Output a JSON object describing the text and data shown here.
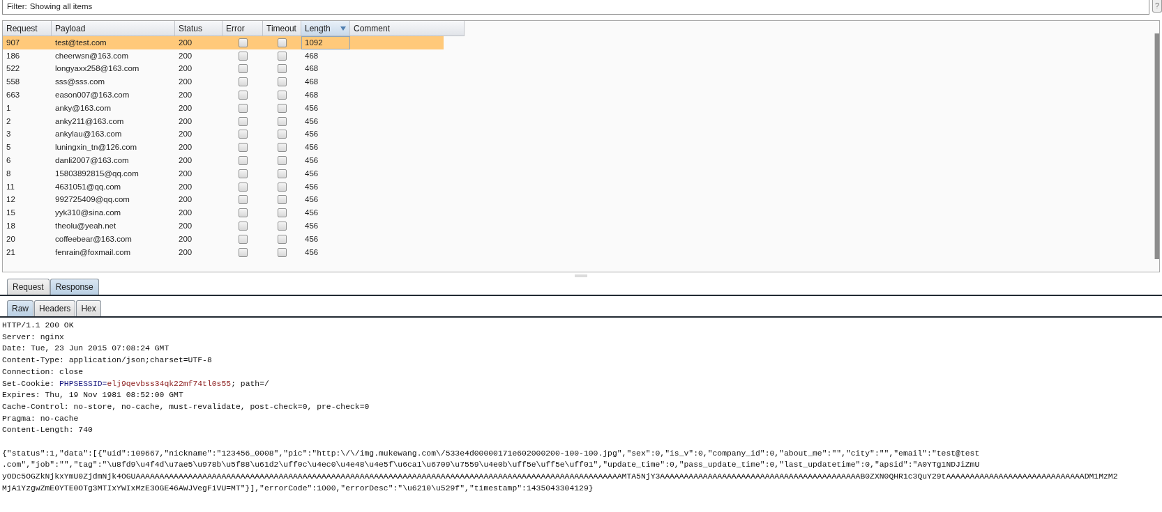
{
  "filter": {
    "label": "Filter:",
    "value": "Showing all items"
  },
  "help_button": {
    "label": "?"
  },
  "table": {
    "columns": [
      {
        "label": "Request",
        "sorted": false
      },
      {
        "label": "Payload",
        "sorted": false
      },
      {
        "label": "Status",
        "sorted": false
      },
      {
        "label": "Error",
        "sorted": false
      },
      {
        "label": "Timeout",
        "sorted": false
      },
      {
        "label": "Length",
        "sorted": true
      },
      {
        "label": "Comment",
        "sorted": false
      }
    ],
    "rows": [
      {
        "request": "907",
        "payload": "test@test.com",
        "status": "200",
        "error": false,
        "timeout": false,
        "length": "1092",
        "selected": true
      },
      {
        "request": "186",
        "payload": "cheerwsn@163.com",
        "status": "200",
        "error": false,
        "timeout": false,
        "length": "468",
        "selected": false
      },
      {
        "request": "522",
        "payload": "longyaxx258@163.com",
        "status": "200",
        "error": false,
        "timeout": false,
        "length": "468",
        "selected": false
      },
      {
        "request": "558",
        "payload": "sss@sss.com",
        "status": "200",
        "error": false,
        "timeout": false,
        "length": "468",
        "selected": false
      },
      {
        "request": "663",
        "payload": "eason007@163.com",
        "status": "200",
        "error": false,
        "timeout": false,
        "length": "468",
        "selected": false
      },
      {
        "request": "1",
        "payload": "anky@163.com",
        "status": "200",
        "error": false,
        "timeout": false,
        "length": "456",
        "selected": false
      },
      {
        "request": "2",
        "payload": "anky211@163.com",
        "status": "200",
        "error": false,
        "timeout": false,
        "length": "456",
        "selected": false
      },
      {
        "request": "3",
        "payload": "ankylau@163.com",
        "status": "200",
        "error": false,
        "timeout": false,
        "length": "456",
        "selected": false
      },
      {
        "request": "5",
        "payload": "luningxin_tn@126.com",
        "status": "200",
        "error": false,
        "timeout": false,
        "length": "456",
        "selected": false
      },
      {
        "request": "6",
        "payload": "danli2007@163.com",
        "status": "200",
        "error": false,
        "timeout": false,
        "length": "456",
        "selected": false
      },
      {
        "request": "8",
        "payload": "15803892815@qq.com",
        "status": "200",
        "error": false,
        "timeout": false,
        "length": "456",
        "selected": false
      },
      {
        "request": "11",
        "payload": "4631051@qq.com",
        "status": "200",
        "error": false,
        "timeout": false,
        "length": "456",
        "selected": false
      },
      {
        "request": "12",
        "payload": "992725409@qq.com",
        "status": "200",
        "error": false,
        "timeout": false,
        "length": "456",
        "selected": false
      },
      {
        "request": "15",
        "payload": "yyk310@sina.com",
        "status": "200",
        "error": false,
        "timeout": false,
        "length": "456",
        "selected": false
      },
      {
        "request": "18",
        "payload": "theolu@yeah.net",
        "status": "200",
        "error": false,
        "timeout": false,
        "length": "456",
        "selected": false
      },
      {
        "request": "20",
        "payload": "coffeebear@163.com",
        "status": "200",
        "error": false,
        "timeout": false,
        "length": "456",
        "selected": false
      },
      {
        "request": "21",
        "payload": "fenrain@foxmail.com",
        "status": "200",
        "error": false,
        "timeout": false,
        "length": "456",
        "selected": false
      }
    ]
  },
  "message_tabs": [
    {
      "label": "Request",
      "selected": false
    },
    {
      "label": "Response",
      "selected": true
    }
  ],
  "view_tabs": [
    {
      "label": "Raw",
      "selected": true
    },
    {
      "label": "Headers",
      "selected": false
    },
    {
      "label": "Hex",
      "selected": false
    }
  ],
  "response_lines": [
    {
      "kind": "plain",
      "text": "HTTP/1.1 200 OK"
    },
    {
      "kind": "plain",
      "text": "Server: nginx"
    },
    {
      "kind": "plain",
      "text": "Date: Tue, 23 Jun 2015 07:08:24 GMT"
    },
    {
      "kind": "plain",
      "text": "Content-Type: application/json;charset=UTF-8"
    },
    {
      "kind": "plain",
      "text": "Connection: close"
    },
    {
      "kind": "cookie",
      "label": "Set-Cookie: ",
      "name": "PHPSESSID=",
      "value": "elj9qevbss34qk22mf74tl0s55",
      "rest": "; path=/"
    },
    {
      "kind": "plain",
      "text": "Expires: Thu, 19 Nov 1981 08:52:00 GMT"
    },
    {
      "kind": "plain",
      "text": "Cache-Control: no-store, no-cache, must-revalidate, post-check=0, pre-check=0"
    },
    {
      "kind": "plain",
      "text": "Pragma: no-cache"
    },
    {
      "kind": "plain",
      "text": "Content-Length: 740"
    },
    {
      "kind": "blank"
    },
    {
      "kind": "plain",
      "text": "{\"status\":1,\"data\":[{\"uid\":109667,\"nickname\":\"123456_0008\",\"pic\":\"http:\\/\\/img.mukewang.com\\/533e4d00000171e602000200-100-100.jpg\",\"sex\":0,\"is_v\":0,\"company_id\":0,\"about_me\":\"\",\"city\":\"\",\"email\":\"test@test"
    },
    {
      "kind": "plain",
      "text": ".com\",\"job\":\"\",\"tag\":\"\\u8fd9\\u4f4d\\u7ae5\\u978b\\u5f88\\u61d2\\uff0c\\u4ec0\\u4e48\\u4e5f\\u6ca1\\u6709\\u7559\\u4e0b\\uff5e\\uff5e\\uff01\",\"update_time\":0,\"pass_update_time\":0,\"last_updatetime\":0,\"apsid\":\"A0YTg1NDJiZmU"
    },
    {
      "kind": "plain",
      "text": "yODc5OGZkNjkxYmU0ZjdmNjk4OGUAAAAAAAAAAAAAAAAAAAAAAAAAAAAAAAAAAAAAAAAAAAAAAAAAAAAAAAAAAAAAAAAAAAAAAAAAAAAAAAAAAAAAAAAAAAAAAAAAAAAAAMTA5NjY3AAAAAAAAAAAAAAAAAAAAAAAAAAAAAAAAAAAAAAAAAAB0ZXN0QHR1c3QuY29tAAAAAAAAAAAAAAAAAAAAAAAAAAAAADM1MzM2"
    },
    {
      "kind": "plain",
      "text": "MjA1YzgwZmE0YTE0OTg3MTIxYWIxMzE3OGE46AWJVegFiVU=MT\"}],\"errorCode\":1000,\"errorDesc\":\"\\u6210\\u529f\",\"timestamp\":1435043304129}"
    }
  ]
}
